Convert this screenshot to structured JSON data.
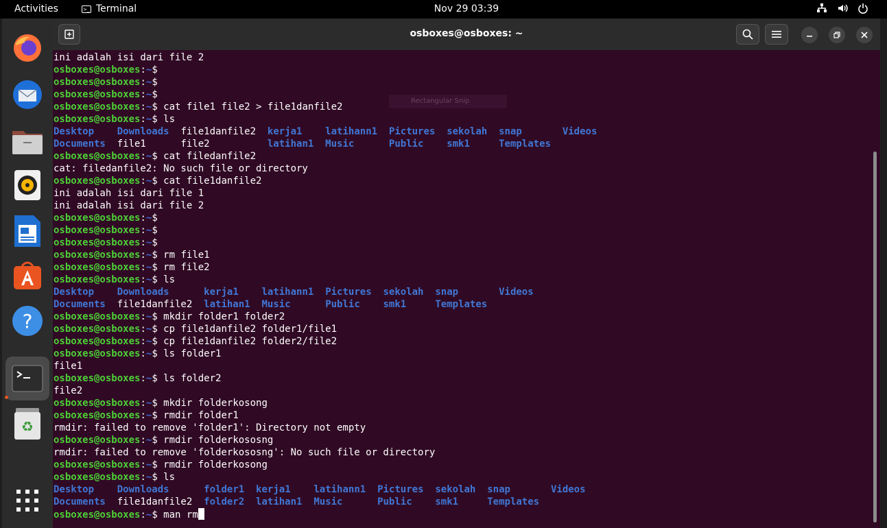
{
  "topbar": {
    "activities": "Activities",
    "app_name": "Terminal",
    "clock": "Nov 29  03:39"
  },
  "dock": {
    "items": [
      "firefox-icon",
      "thunderbird-icon",
      "files-icon",
      "rhythmbox-icon",
      "libreoffice-writer-icon",
      "app-center-icon",
      "help-icon",
      "terminal-icon",
      "trash-icon",
      "show-apps-icon"
    ]
  },
  "window": {
    "title": "osboxes@osboxes: ~"
  },
  "overlay": {
    "snip_label": "Rectangular Snip"
  },
  "terminal": {
    "lines": [
      [
        {
          "t": "ini adalah isi dari file 2",
          "c": ""
        }
      ],
      [
        {
          "t": "osboxes@osboxes",
          "c": "p-user"
        },
        {
          "t": ":",
          "c": ""
        },
        {
          "t": "~",
          "c": "p-path"
        },
        {
          "t": "$ ",
          "c": ""
        }
      ],
      [
        {
          "t": "osboxes@osboxes",
          "c": "p-user"
        },
        {
          "t": ":",
          "c": ""
        },
        {
          "t": "~",
          "c": "p-path"
        },
        {
          "t": "$ ",
          "c": ""
        }
      ],
      [
        {
          "t": "osboxes@osboxes",
          "c": "p-user"
        },
        {
          "t": ":",
          "c": ""
        },
        {
          "t": "~",
          "c": "p-path"
        },
        {
          "t": "$ ",
          "c": ""
        }
      ],
      [
        {
          "t": "osboxes@osboxes",
          "c": "p-user"
        },
        {
          "t": ":",
          "c": ""
        },
        {
          "t": "~",
          "c": "p-path"
        },
        {
          "t": "$ cat file1 file2 > file1danfile2",
          "c": ""
        }
      ],
      [
        {
          "t": "osboxes@osboxes",
          "c": "p-user"
        },
        {
          "t": ":",
          "c": ""
        },
        {
          "t": "~",
          "c": "p-path"
        },
        {
          "t": "$ ls",
          "c": ""
        }
      ],
      [
        {
          "t": "Desktop",
          "c": "dir"
        },
        {
          "t": "    ",
          "c": ""
        },
        {
          "t": "Downloads",
          "c": "dir"
        },
        {
          "t": "  file1danfile2  ",
          "c": ""
        },
        {
          "t": "kerja1",
          "c": "dir"
        },
        {
          "t": "    ",
          "c": ""
        },
        {
          "t": "latihann1",
          "c": "dir"
        },
        {
          "t": "  ",
          "c": ""
        },
        {
          "t": "Pictures",
          "c": "dir"
        },
        {
          "t": "  ",
          "c": ""
        },
        {
          "t": "sekolah",
          "c": "dir"
        },
        {
          "t": "  ",
          "c": ""
        },
        {
          "t": "snap",
          "c": "dir"
        },
        {
          "t": "       ",
          "c": ""
        },
        {
          "t": "Videos",
          "c": "dir"
        }
      ],
      [
        {
          "t": "Documents",
          "c": "dir"
        },
        {
          "t": "  file1      file2          ",
          "c": ""
        },
        {
          "t": "latihan1",
          "c": "dir"
        },
        {
          "t": "  ",
          "c": ""
        },
        {
          "t": "Music",
          "c": "dir"
        },
        {
          "t": "      ",
          "c": ""
        },
        {
          "t": "Public",
          "c": "dir"
        },
        {
          "t": "    ",
          "c": ""
        },
        {
          "t": "smk1",
          "c": "dir"
        },
        {
          "t": "     ",
          "c": ""
        },
        {
          "t": "Templates",
          "c": "dir"
        }
      ],
      [
        {
          "t": "osboxes@osboxes",
          "c": "p-user"
        },
        {
          "t": ":",
          "c": ""
        },
        {
          "t": "~",
          "c": "p-path"
        },
        {
          "t": "$ cat filedanfile2",
          "c": ""
        }
      ],
      [
        {
          "t": "cat: filedanfile2: No such file or directory",
          "c": ""
        }
      ],
      [
        {
          "t": "osboxes@osboxes",
          "c": "p-user"
        },
        {
          "t": ":",
          "c": ""
        },
        {
          "t": "~",
          "c": "p-path"
        },
        {
          "t": "$ cat file1danfile2",
          "c": ""
        }
      ],
      [
        {
          "t": "ini adalah isi dari file 1",
          "c": ""
        }
      ],
      [
        {
          "t": "ini adalah isi dari file 2",
          "c": ""
        }
      ],
      [
        {
          "t": "osboxes@osboxes",
          "c": "p-user"
        },
        {
          "t": ":",
          "c": ""
        },
        {
          "t": "~",
          "c": "p-path"
        },
        {
          "t": "$ ",
          "c": ""
        }
      ],
      [
        {
          "t": "osboxes@osboxes",
          "c": "p-user"
        },
        {
          "t": ":",
          "c": ""
        },
        {
          "t": "~",
          "c": "p-path"
        },
        {
          "t": "$ ",
          "c": ""
        }
      ],
      [
        {
          "t": "osboxes@osboxes",
          "c": "p-user"
        },
        {
          "t": ":",
          "c": ""
        },
        {
          "t": "~",
          "c": "p-path"
        },
        {
          "t": "$ ",
          "c": ""
        }
      ],
      [
        {
          "t": "osboxes@osboxes",
          "c": "p-user"
        },
        {
          "t": ":",
          "c": ""
        },
        {
          "t": "~",
          "c": "p-path"
        },
        {
          "t": "$ rm file1",
          "c": ""
        }
      ],
      [
        {
          "t": "osboxes@osboxes",
          "c": "p-user"
        },
        {
          "t": ":",
          "c": ""
        },
        {
          "t": "~",
          "c": "p-path"
        },
        {
          "t": "$ rm file2",
          "c": ""
        }
      ],
      [
        {
          "t": "osboxes@osboxes",
          "c": "p-user"
        },
        {
          "t": ":",
          "c": ""
        },
        {
          "t": "~",
          "c": "p-path"
        },
        {
          "t": "$ ls",
          "c": ""
        }
      ],
      [
        {
          "t": "Desktop",
          "c": "dir"
        },
        {
          "t": "    ",
          "c": ""
        },
        {
          "t": "Downloads",
          "c": "dir"
        },
        {
          "t": "      ",
          "c": ""
        },
        {
          "t": "kerja1",
          "c": "dir"
        },
        {
          "t": "    ",
          "c": ""
        },
        {
          "t": "latihann1",
          "c": "dir"
        },
        {
          "t": "  ",
          "c": ""
        },
        {
          "t": "Pictures",
          "c": "dir"
        },
        {
          "t": "  ",
          "c": ""
        },
        {
          "t": "sekolah",
          "c": "dir"
        },
        {
          "t": "  ",
          "c": ""
        },
        {
          "t": "snap",
          "c": "dir"
        },
        {
          "t": "       ",
          "c": ""
        },
        {
          "t": "Videos",
          "c": "dir"
        }
      ],
      [
        {
          "t": "Documents",
          "c": "dir"
        },
        {
          "t": "  file1danfile2  ",
          "c": ""
        },
        {
          "t": "latihan1",
          "c": "dir"
        },
        {
          "t": "  ",
          "c": ""
        },
        {
          "t": "Music",
          "c": "dir"
        },
        {
          "t": "      ",
          "c": ""
        },
        {
          "t": "Public",
          "c": "dir"
        },
        {
          "t": "    ",
          "c": ""
        },
        {
          "t": "smk1",
          "c": "dir"
        },
        {
          "t": "     ",
          "c": ""
        },
        {
          "t": "Templates",
          "c": "dir"
        }
      ],
      [
        {
          "t": "osboxes@osboxes",
          "c": "p-user"
        },
        {
          "t": ":",
          "c": ""
        },
        {
          "t": "~",
          "c": "p-path"
        },
        {
          "t": "$ mkdir folder1 folder2",
          "c": ""
        }
      ],
      [
        {
          "t": "osboxes@osboxes",
          "c": "p-user"
        },
        {
          "t": ":",
          "c": ""
        },
        {
          "t": "~",
          "c": "p-path"
        },
        {
          "t": "$ cp file1danfile2 folder1/file1",
          "c": ""
        }
      ],
      [
        {
          "t": "osboxes@osboxes",
          "c": "p-user"
        },
        {
          "t": ":",
          "c": ""
        },
        {
          "t": "~",
          "c": "p-path"
        },
        {
          "t": "$ cp file1danfile2 folder2/file2",
          "c": ""
        }
      ],
      [
        {
          "t": "osboxes@osboxes",
          "c": "p-user"
        },
        {
          "t": ":",
          "c": ""
        },
        {
          "t": "~",
          "c": "p-path"
        },
        {
          "t": "$ ls folder1",
          "c": ""
        }
      ],
      [
        {
          "t": "file1",
          "c": ""
        }
      ],
      [
        {
          "t": "osboxes@osboxes",
          "c": "p-user"
        },
        {
          "t": ":",
          "c": ""
        },
        {
          "t": "~",
          "c": "p-path"
        },
        {
          "t": "$ ls folder2",
          "c": ""
        }
      ],
      [
        {
          "t": "file2",
          "c": ""
        }
      ],
      [
        {
          "t": "osboxes@osboxes",
          "c": "p-user"
        },
        {
          "t": ":",
          "c": ""
        },
        {
          "t": "~",
          "c": "p-path"
        },
        {
          "t": "$ mkdir folderkosong",
          "c": ""
        }
      ],
      [
        {
          "t": "osboxes@osboxes",
          "c": "p-user"
        },
        {
          "t": ":",
          "c": ""
        },
        {
          "t": "~",
          "c": "p-path"
        },
        {
          "t": "$ rmdir folder1",
          "c": ""
        }
      ],
      [
        {
          "t": "rmdir: failed to remove 'folder1': Directory not empty",
          "c": ""
        }
      ],
      [
        {
          "t": "osboxes@osboxes",
          "c": "p-user"
        },
        {
          "t": ":",
          "c": ""
        },
        {
          "t": "~",
          "c": "p-path"
        },
        {
          "t": "$ rmdir folderkososng",
          "c": ""
        }
      ],
      [
        {
          "t": "rmdir: failed to remove 'folderkososng': No such file or directory",
          "c": ""
        }
      ],
      [
        {
          "t": "osboxes@osboxes",
          "c": "p-user"
        },
        {
          "t": ":",
          "c": ""
        },
        {
          "t": "~",
          "c": "p-path"
        },
        {
          "t": "$ rmdir folderkosong",
          "c": ""
        }
      ],
      [
        {
          "t": "osboxes@osboxes",
          "c": "p-user"
        },
        {
          "t": ":",
          "c": ""
        },
        {
          "t": "~",
          "c": "p-path"
        },
        {
          "t": "$ ls",
          "c": ""
        }
      ],
      [
        {
          "t": "Desktop",
          "c": "dir"
        },
        {
          "t": "    ",
          "c": ""
        },
        {
          "t": "Downloads",
          "c": "dir"
        },
        {
          "t": "      ",
          "c": ""
        },
        {
          "t": "folder1",
          "c": "dir"
        },
        {
          "t": "  ",
          "c": ""
        },
        {
          "t": "kerja1",
          "c": "dir"
        },
        {
          "t": "    ",
          "c": ""
        },
        {
          "t": "latihann1",
          "c": "dir"
        },
        {
          "t": "  ",
          "c": ""
        },
        {
          "t": "Pictures",
          "c": "dir"
        },
        {
          "t": "  ",
          "c": ""
        },
        {
          "t": "sekolah",
          "c": "dir"
        },
        {
          "t": "  ",
          "c": ""
        },
        {
          "t": "snap",
          "c": "dir"
        },
        {
          "t": "       ",
          "c": ""
        },
        {
          "t": "Videos",
          "c": "dir"
        }
      ],
      [
        {
          "t": "Documents",
          "c": "dir"
        },
        {
          "t": "  file1danfile2  ",
          "c": ""
        },
        {
          "t": "folder2",
          "c": "dir"
        },
        {
          "t": "  ",
          "c": ""
        },
        {
          "t": "latihan1",
          "c": "dir"
        },
        {
          "t": "  ",
          "c": ""
        },
        {
          "t": "Music",
          "c": "dir"
        },
        {
          "t": "      ",
          "c": ""
        },
        {
          "t": "Public",
          "c": "dir"
        },
        {
          "t": "    ",
          "c": ""
        },
        {
          "t": "smk1",
          "c": "dir"
        },
        {
          "t": "     ",
          "c": ""
        },
        {
          "t": "Templates",
          "c": "dir"
        }
      ],
      [
        {
          "t": "osboxes@osboxes",
          "c": "p-user"
        },
        {
          "t": ":",
          "c": ""
        },
        {
          "t": "~",
          "c": "p-path"
        },
        {
          "t": "$ man rm",
          "c": ""
        }
      ]
    ]
  }
}
